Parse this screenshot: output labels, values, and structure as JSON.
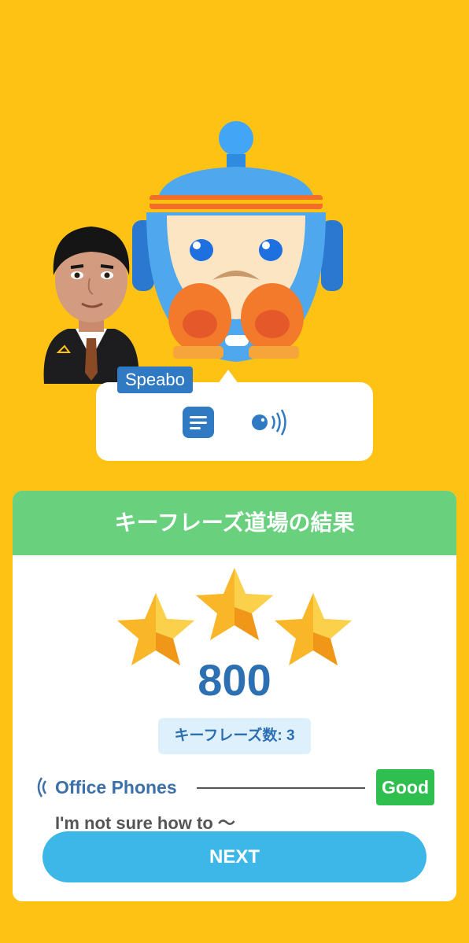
{
  "speaker": {
    "name": "Speabo"
  },
  "bubble": {
    "text_icon": "text-message-icon",
    "audio_icon": "speaker-audio-icon"
  },
  "result": {
    "title": "キーフレーズ道場の結果",
    "stars_earned": 3,
    "stars_total": 3,
    "score": "800",
    "count_label": "キーフレーズ数: 3"
  },
  "phrase": {
    "icon": "sound-wave-icon",
    "title": "Office Phones",
    "rating": "Good",
    "subtitle": "I'm not sure how to 〜"
  },
  "next_button": {
    "label": "NEXT"
  },
  "colors": {
    "background": "#FEC215",
    "header": "#69D07E",
    "accent_blue": "#2C6FB3",
    "good": "#2FBF4F",
    "next": "#3DB6E8"
  }
}
